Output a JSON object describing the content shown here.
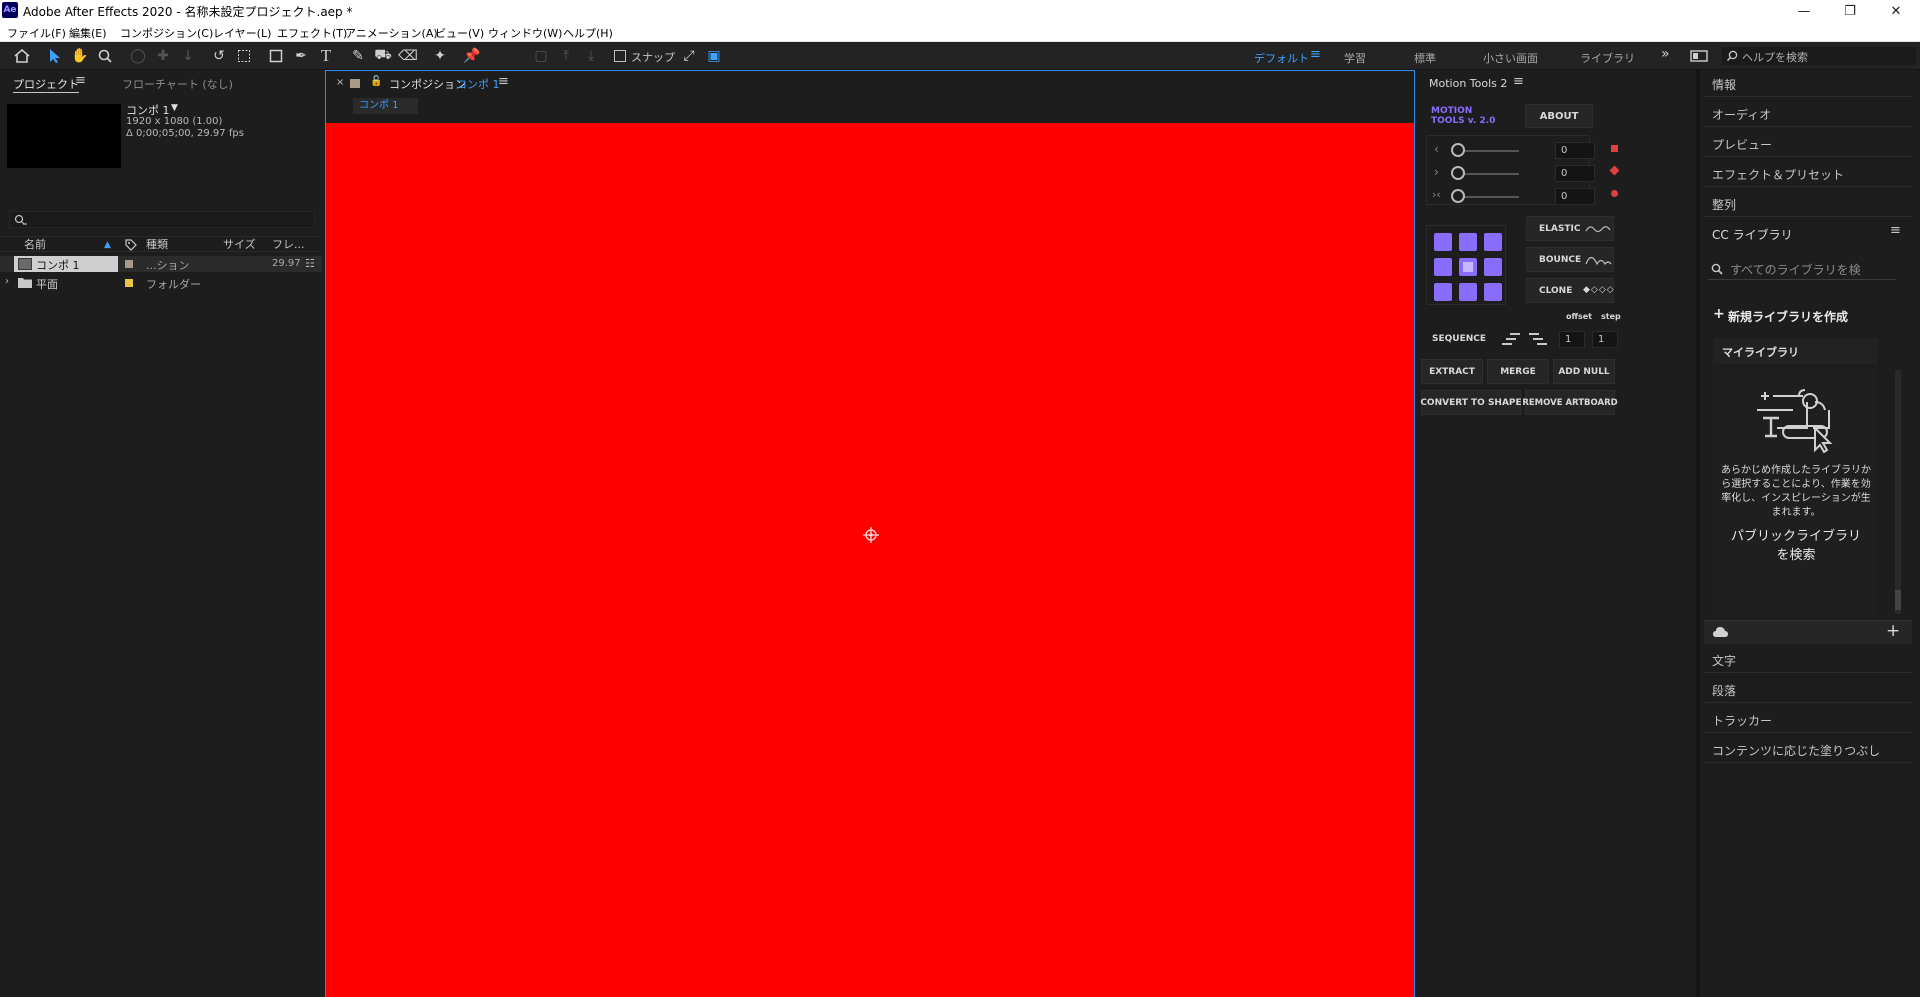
{
  "window": {
    "app_icon": "Ae",
    "title": "Adobe After Effects 2020 - 名称未設定プロジェクト.aep *",
    "controls": [
      "minimize-icon",
      "restore-icon",
      "close-icon"
    ]
  },
  "menu": [
    "ファイル(F)",
    "編集(E)",
    "コンポジション(C)",
    "レイヤー(L)",
    "エフェクト(T)",
    "アニメーション(A)",
    "ビュー(V)",
    "ウィンドウ(W)",
    "ヘルプ(H)"
  ],
  "toolbar": {
    "snap_label": "スナップ",
    "workspaces": [
      "デフォルト",
      "学習",
      "標準",
      "小さい画面",
      "ライブラリ"
    ],
    "active_workspace": "デフォルト",
    "help_search_placeholder": "ヘルプを検索"
  },
  "project": {
    "tab_label": "プロジェクト",
    "flowchart_tab": "フローチャート (なし)",
    "selected": {
      "name": "コンポ 1",
      "size": "1920 x 1080 (1.00)",
      "duration": "Δ 0;00;05;00, 29.97 fps"
    },
    "search_placeholder": "",
    "columns": [
      "名前",
      "種類",
      "サイズ",
      "フレ..."
    ],
    "rows": [
      {
        "name": "コンポ 1",
        "type": "...ション",
        "fps": "29.97",
        "label_color": "#a89a84",
        "selected": true
      },
      {
        "name": "平面",
        "type": "フォルダー",
        "fps": "",
        "label_color": "#e8c44a",
        "selected": false
      }
    ]
  },
  "composition": {
    "tab_prefix": "コンポジション",
    "tab_name": "コンポ 1",
    "breadcrumb": "コンポ 1",
    "canvas_color": "#ff0000"
  },
  "motion_tools": {
    "panel_title": "Motion Tools 2",
    "logo_line1": "MOTION",
    "logo_line2": "TOOLS v. 2.0",
    "about": "ABOUT",
    "sliders": [
      {
        "value": "0",
        "marker_color": "#e04040"
      },
      {
        "value": "0",
        "marker_color": "#e04040"
      },
      {
        "value": "0",
        "marker_color": "#e04040"
      }
    ],
    "elastic": "ELASTIC",
    "bounce": "BOUNCE",
    "clone": "CLONE",
    "offset_label": "offset",
    "step_label": "step",
    "sequence": "SEQUENCE",
    "offset_value": "1",
    "step_value": "1",
    "extract": "EXTRACT",
    "merge": "MERGE",
    "add_null": "ADD NULL",
    "convert_to_shape": "CONVERT TO SHAPE",
    "remove_artboard": "REMOVE ARTBOARD",
    "accent_color": "#8a6cff"
  },
  "dock": {
    "top_items": [
      "情報",
      "オーディオ",
      "プレビュー",
      "エフェクト＆プリセット",
      "整列"
    ],
    "cc_libraries": {
      "title": "CC ライブラリ",
      "search_placeholder": "すべてのライブラリを検",
      "create_new": "新規ライブラリを作成",
      "my_library": "マイライブラリ",
      "description": "あらかじめ作成したライブラリから選択することにより、作業を効率化し、インスピレーションが生まれます。",
      "public_search": "パブリックライブラリを検索"
    },
    "bottom_items": [
      "文字",
      "段落",
      "トラッカー",
      "コンテンツに応じた塗りつぶし"
    ]
  }
}
